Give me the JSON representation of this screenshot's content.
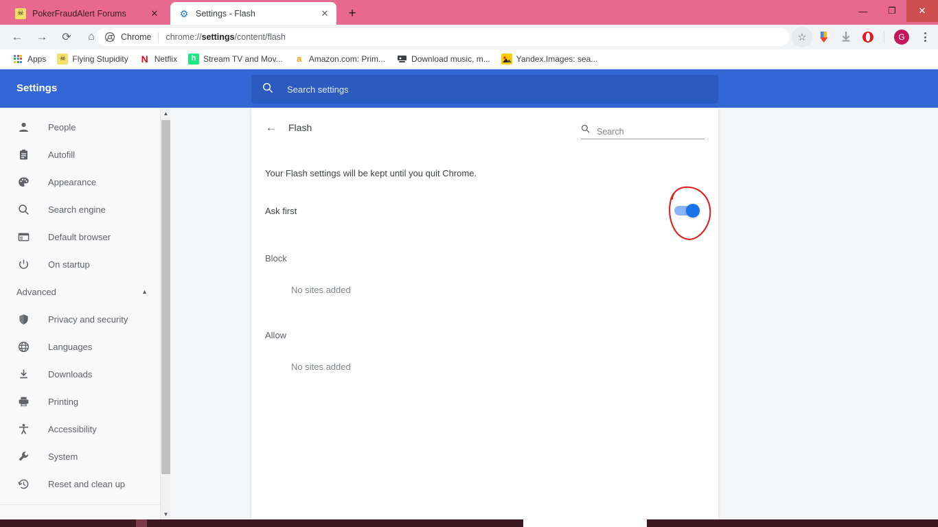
{
  "window": {
    "theme_color": "#e8698f",
    "close_color": "#cc4e4e",
    "minimize": "—",
    "maximize": "❐",
    "close": "✕"
  },
  "tabs": [
    {
      "title": "PokerFraudAlert Forums",
      "favicon": "skull-icon",
      "glyph": "☠",
      "active": false,
      "close": "✕"
    },
    {
      "title": "Settings - Flash",
      "favicon": "gear-icon",
      "glyph": "⚙",
      "active": true,
      "close": "✕"
    }
  ],
  "newtab_label": "+",
  "toolbar": {
    "back": "←",
    "forward": "→",
    "reload": "⟳",
    "home": "⌂",
    "omnibox": {
      "chip": "Chrome",
      "url_prefix": "chrome://",
      "url_bold": "settings",
      "url_suffix": "/content/flash",
      "site_icon": "chrome-icon"
    },
    "bookmark_star": "☆",
    "extension_download": "⬇",
    "downloads": "⬇",
    "extension_opera": "◉",
    "avatar_letter": "G",
    "avatar_color": "#c2185b",
    "menu": "kebab-menu-icon"
  },
  "bookmarks": [
    {
      "label": "Apps",
      "icon": "apps-grid-icon"
    },
    {
      "label": "Flying Stupidity",
      "icon": "skull-icon",
      "glyph": "☠"
    },
    {
      "label": "Netflix",
      "icon": "netflix-icon",
      "glyph": "N"
    },
    {
      "label": "Stream TV and Mov...",
      "icon": "hulu-icon",
      "glyph": "h"
    },
    {
      "label": "Amazon.com: Prim...",
      "icon": "amazon-icon",
      "glyph": "a"
    },
    {
      "label": "Download music, m...",
      "icon": "music-download-icon",
      "glyph": "▤"
    },
    {
      "label": "Yandex.Images: sea...",
      "icon": "yandex-images-icon",
      "glyph": "▲"
    }
  ],
  "settings": {
    "title": "Settings",
    "header_color": "#3367d6",
    "search": {
      "placeholder": "Search settings",
      "value": "",
      "icon": "search-icon"
    }
  },
  "sidebar": {
    "items": [
      {
        "label": "People",
        "icon": "person-icon"
      },
      {
        "label": "Autofill",
        "icon": "clipboard-icon"
      },
      {
        "label": "Appearance",
        "icon": "palette-icon"
      },
      {
        "label": "Search engine",
        "icon": "search-icon"
      },
      {
        "label": "Default browser",
        "icon": "browser-window-icon"
      },
      {
        "label": "On startup",
        "icon": "power-icon"
      }
    ],
    "advanced": {
      "label": "Advanced",
      "expanded": true,
      "chevron": "▲"
    },
    "advanced_items": [
      {
        "label": "Privacy and security",
        "icon": "shield-icon"
      },
      {
        "label": "Languages",
        "icon": "globe-icon"
      },
      {
        "label": "Downloads",
        "icon": "download-icon"
      },
      {
        "label": "Printing",
        "icon": "printer-icon"
      },
      {
        "label": "Accessibility",
        "icon": "accessibility-icon"
      },
      {
        "label": "System",
        "icon": "wrench-icon"
      },
      {
        "label": "Reset and clean up",
        "icon": "history-restore-icon"
      }
    ],
    "scrollbar": {
      "up": "▲",
      "down": "▼"
    }
  },
  "main": {
    "back_arrow": "←",
    "page_title": "Flash",
    "search": {
      "placeholder": "Search",
      "value": "",
      "icon": "search-icon"
    },
    "note": "Your Flash settings will be kept until you quit Chrome.",
    "toggle": {
      "label": "Ask first",
      "state": "on",
      "on_color": "#1a73e8",
      "track_color": "#8ab4f8"
    },
    "sections": [
      {
        "title": "Block",
        "empty_text": "No sites added"
      },
      {
        "title": "Allow",
        "empty_text": "No sites added"
      }
    ],
    "annotation": {
      "type": "hand-drawn-circle",
      "color": "#e02020",
      "target": "ask-first-toggle"
    }
  }
}
